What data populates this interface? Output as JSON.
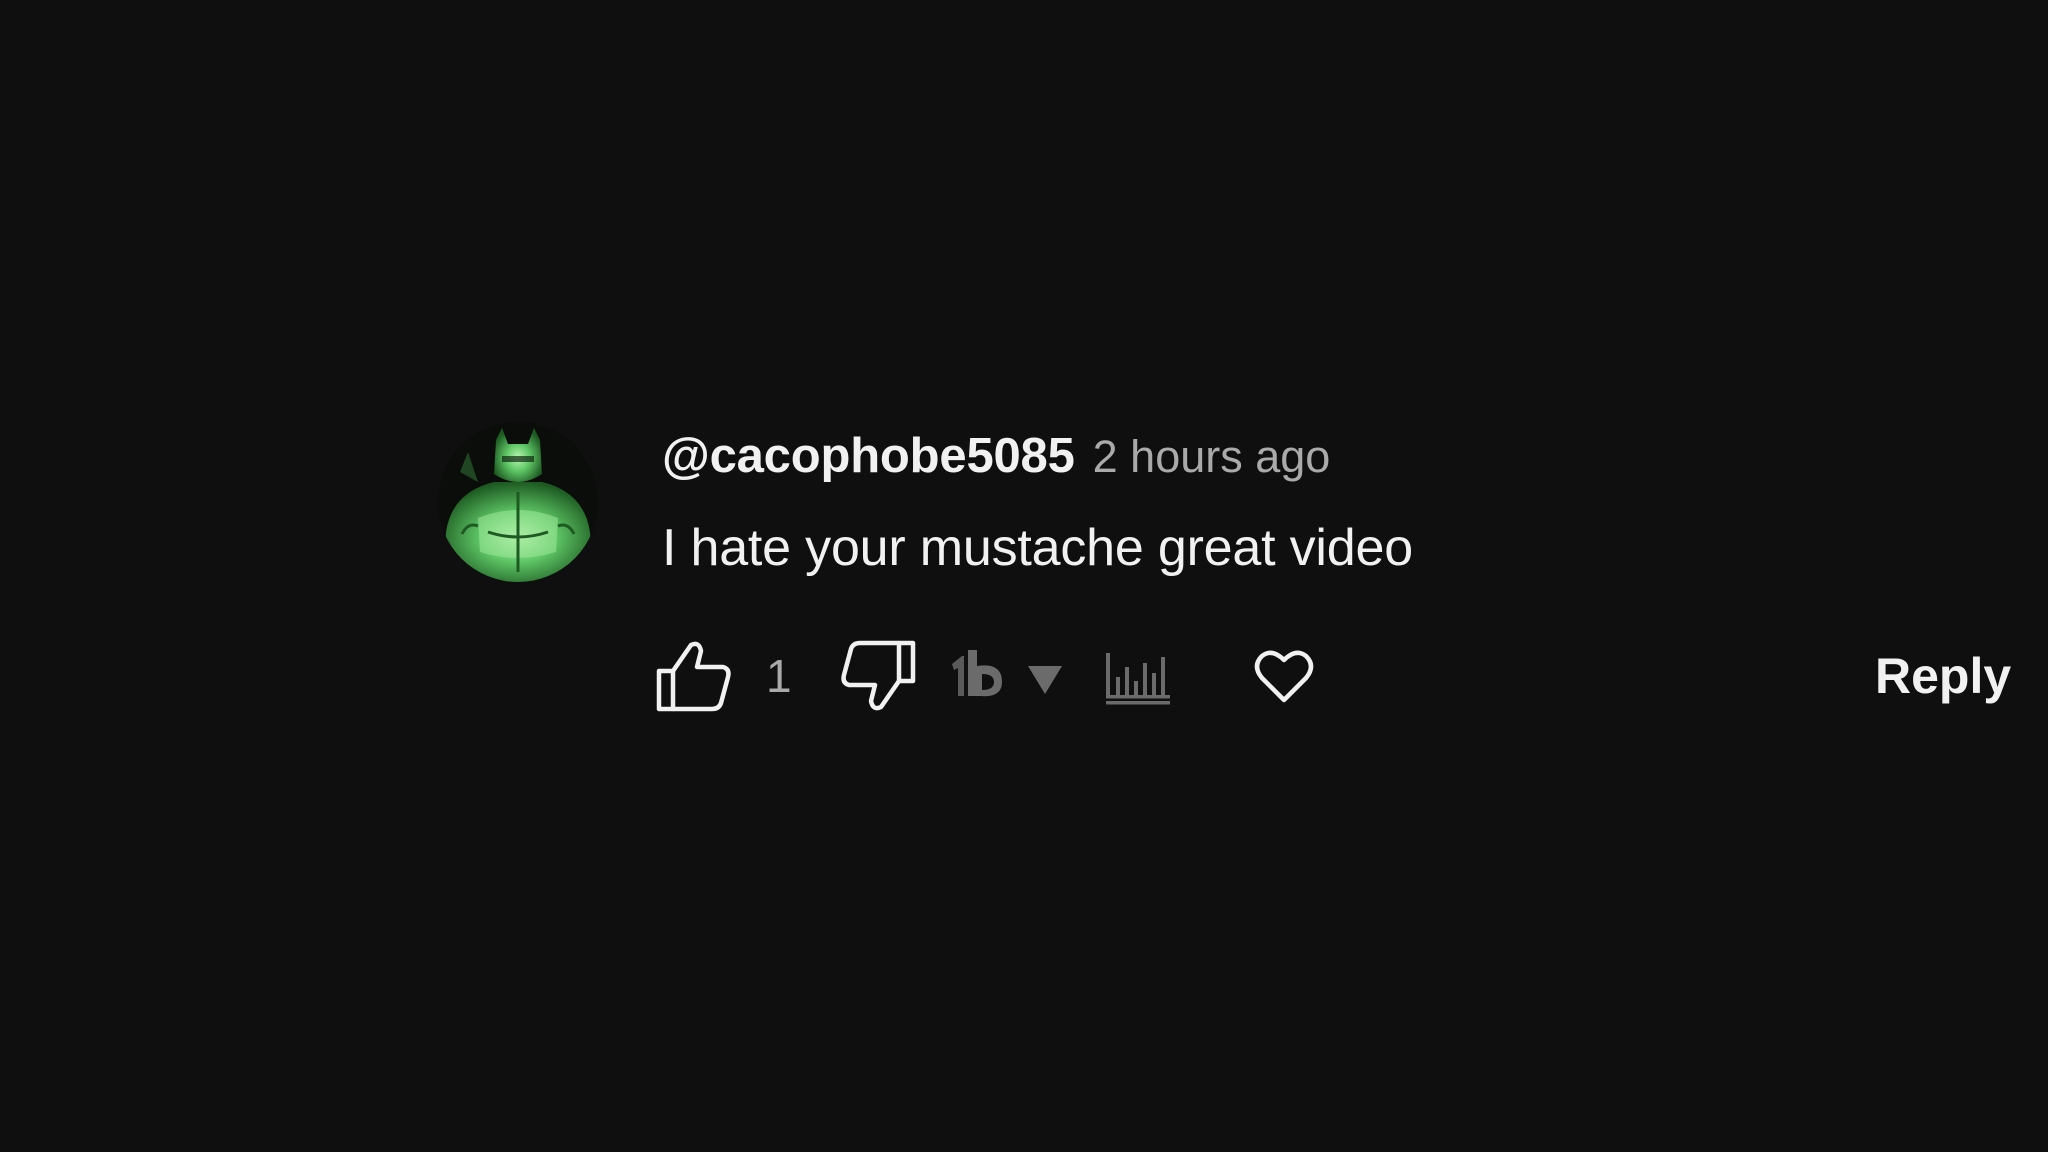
{
  "comment": {
    "author": "@cacophobe5085",
    "timestamp": "2 hours ago",
    "text": "I hate your mustache great video",
    "avatar_icon": "green-armored-figure-avatar",
    "actions": {
      "like_icon": "thumbs-up-icon",
      "like_count": "1",
      "dislike_icon": "thumbs-down-icon",
      "extension_icon": "extension-logo-icon",
      "extension_dropdown_icon": "triangle-down-icon",
      "stats_icon": "bar-chart-icon",
      "heart_icon": "heart-outline-icon",
      "reply_label": "Reply"
    }
  },
  "colors": {
    "background": "#0f0f0f",
    "primary_text": "#f1f1f1",
    "secondary_text": "#aaaaaa",
    "muted_icon": "#6b6b6b",
    "avatar_green": "#6fd873"
  }
}
